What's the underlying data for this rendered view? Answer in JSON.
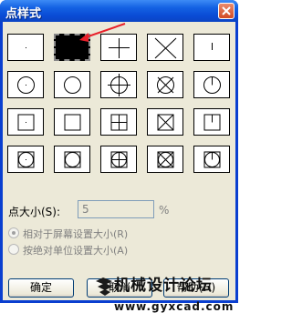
{
  "window": {
    "title": "点样式"
  },
  "point_styles": [
    {
      "id": 0,
      "selected": false
    },
    {
      "id": 1,
      "selected": true
    },
    {
      "id": 2,
      "selected": false
    },
    {
      "id": 3,
      "selected": false
    },
    {
      "id": 4,
      "selected": false
    },
    {
      "id": 32
    },
    {
      "id": 33
    },
    {
      "id": 34
    },
    {
      "id": 35
    },
    {
      "id": 36
    },
    {
      "id": 64
    },
    {
      "id": 65
    },
    {
      "id": 66
    },
    {
      "id": 67
    },
    {
      "id": 68
    },
    {
      "id": 96
    },
    {
      "id": 97
    },
    {
      "id": 98
    },
    {
      "id": 99
    },
    {
      "id": 100
    }
  ],
  "size": {
    "label": "点大小(S):",
    "value": "5",
    "unit": "%"
  },
  "options": [
    {
      "label": "相对于屏幕设置大小(R)",
      "checked": true
    },
    {
      "label": "按绝对单位设置大小(A)",
      "checked": false
    }
  ],
  "buttons": {
    "ok": "确定",
    "cancel": "取消",
    "help": "帮助(H)"
  },
  "watermark": {
    "line1": "机械设计论坛",
    "line2": "www.gyxcad.com"
  },
  "colors": {
    "title_bar": "#0a4cd6",
    "dialog_bg": "#ece9d8",
    "arrow": "#e8202a"
  }
}
